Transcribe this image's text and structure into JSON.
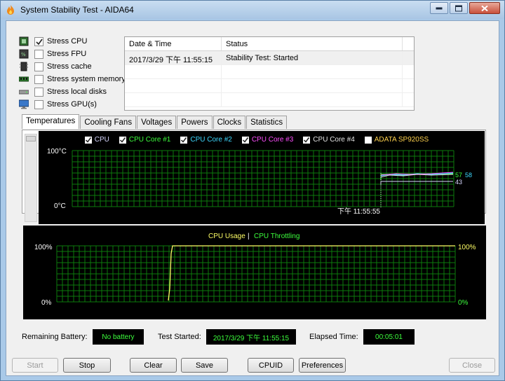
{
  "window": {
    "title": "System Stability Test - AIDA64"
  },
  "stress": [
    {
      "label": "Stress CPU",
      "checked": true,
      "icon": "cpu-chip-icon"
    },
    {
      "label": "Stress FPU",
      "checked": false,
      "icon": "fpu-chip-icon"
    },
    {
      "label": "Stress cache",
      "checked": false,
      "icon": "cache-icon"
    },
    {
      "label": "Stress system memory",
      "checked": false,
      "icon": "memory-module-icon"
    },
    {
      "label": "Stress local disks",
      "checked": false,
      "icon": "disk-drive-icon"
    },
    {
      "label": "Stress GPU(s)",
      "checked": false,
      "icon": "monitor-icon"
    }
  ],
  "status_table": {
    "headers": [
      "Date & Time",
      "Status"
    ],
    "rows": [
      {
        "datetime": "2017/3/29 下午 11:55:15",
        "status": "Stability Test: Started"
      }
    ]
  },
  "tabs": [
    "Temperatures",
    "Cooling Fans",
    "Voltages",
    "Powers",
    "Clocks",
    "Statistics"
  ],
  "active_tab": "Temperatures",
  "temp_chart": {
    "legend": [
      {
        "label": "CPU",
        "checked": true,
        "color": "#d8d8ff"
      },
      {
        "label": "CPU Core #1",
        "checked": true,
        "color": "#3dff3d"
      },
      {
        "label": "CPU Core #2",
        "checked": true,
        "color": "#3dd9ff"
      },
      {
        "label": "CPU Core #3",
        "checked": true,
        "color": "#ff4dff"
      },
      {
        "label": "CPU Core #4",
        "checked": true,
        "color": "#e6e6e6"
      },
      {
        "label": "ADATA SP920SS",
        "checked": false,
        "color": "#ffd24d"
      }
    ],
    "y_max_label": "100°C",
    "y_min_label": "0°C",
    "time_label": "下午 11:55:55",
    "readout_top": "57",
    "readout_side": "58",
    "readout_low": "43"
  },
  "usage_chart": {
    "title_a": "CPU Usage",
    "separator": "|",
    "title_b": "CPU Throttling",
    "left_top": "100%",
    "left_bottom": "0%",
    "right_top": "100%",
    "right_bottom": "0%"
  },
  "info": {
    "battery_label": "Remaining Battery:",
    "battery_value": "No battery",
    "started_label": "Test Started:",
    "started_value": "2017/3/29 下午 11:55:15",
    "elapsed_label": "Elapsed Time:",
    "elapsed_value": "00:05:01"
  },
  "buttons": {
    "start": "Start",
    "stop": "Stop",
    "clear": "Clear",
    "save": "Save",
    "cpuid": "CPUID",
    "preferences": "Preferences",
    "close": "Close"
  },
  "colors": {
    "grid": "#0d7a0d",
    "usage_line": "#ffff66",
    "throttle_text": "#3dff3d",
    "usage_text": "#ffff66",
    "info_text": "#3dff3d"
  }
}
